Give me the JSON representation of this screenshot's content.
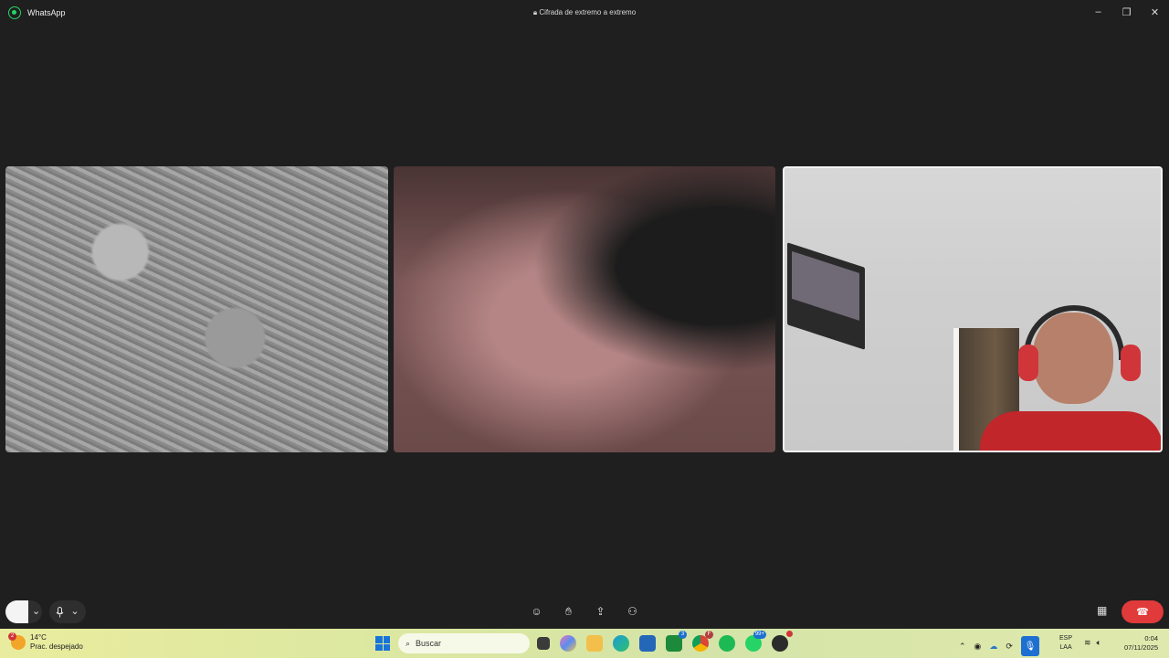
{
  "window": {
    "app_name": "WhatsApp",
    "encryption_label": "Cifrada de extremo a extremo",
    "icons": [
      "lock-icon",
      "minimize-icon",
      "maximize-icon",
      "close-icon"
    ]
  },
  "call": {
    "participants": [
      {
        "id": "participant-1",
        "description_icon": "video-feed"
      },
      {
        "id": "participant-2",
        "description_icon": "video-feed"
      },
      {
        "id": "participant-3",
        "description_icon": "video-feed",
        "active_speaker": true
      }
    ],
    "controls": {
      "camera_toggle_icon": "camera-icon",
      "mic_icon": "microphone-icon",
      "center_icons": [
        "emoji-icon",
        "raise-hand-icon",
        "share-screen-icon",
        "add-participant-icon"
      ],
      "layout_icon": "grid-icon",
      "end_call_icon": "hang-up-icon",
      "end_call_color": "#e03a3a"
    }
  },
  "taskbar": {
    "weather": {
      "badge": "2",
      "temp": "14°C",
      "condition": "Prac. despejado"
    },
    "search_placeholder": "Buscar",
    "app_badges": {
      "xbox": "3",
      "chrome": "F",
      "whatsapp": "99+"
    },
    "language": {
      "line1": "ESP",
      "line2": "LAA"
    },
    "clock": {
      "time": "0:04",
      "date": "07/11/2025"
    }
  }
}
